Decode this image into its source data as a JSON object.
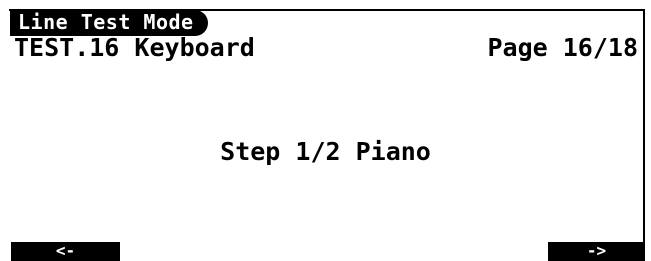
{
  "screen": {
    "mode_label": "Line Test Mode",
    "test_title": "TEST.16 Keyboard",
    "page_indicator": "Page 16/18",
    "step_label": "Step 1/2 Piano"
  },
  "softkeys": {
    "left_label": "<-",
    "right_label": "->"
  },
  "colors": {
    "foreground": "#000000",
    "background": "#ffffff"
  }
}
